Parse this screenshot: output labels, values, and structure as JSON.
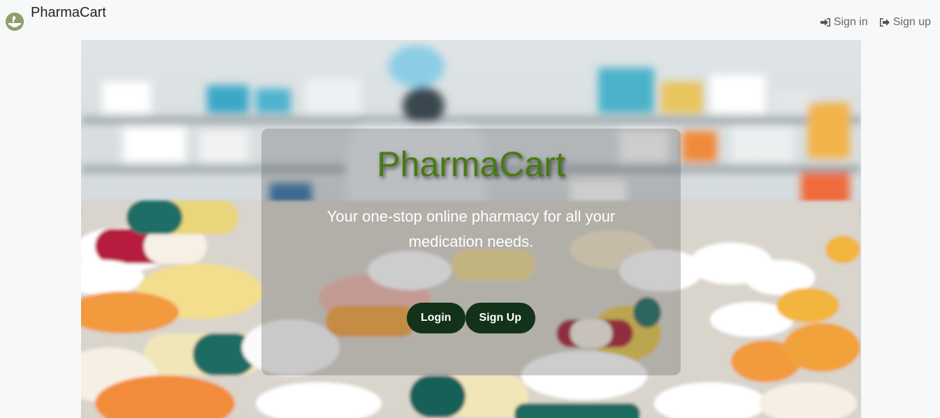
{
  "brand": {
    "name": "PharmaCart",
    "logo_icon": "mortar-pestle-icon"
  },
  "nav": {
    "sign_in": {
      "label": "Sign in",
      "icon": "sign-in-icon"
    },
    "sign_up": {
      "label": "Sign up",
      "icon": "sign-out-icon"
    }
  },
  "hero": {
    "title": "PharmaCart",
    "tagline": "Your one-stop online pharmacy for all your medication needs.",
    "login_label": "Login",
    "signup_label": "Sign Up"
  },
  "colors": {
    "title_green": "#4a7a14",
    "button_dark_green": "#12331a",
    "page_background": "#f7f8fa"
  }
}
